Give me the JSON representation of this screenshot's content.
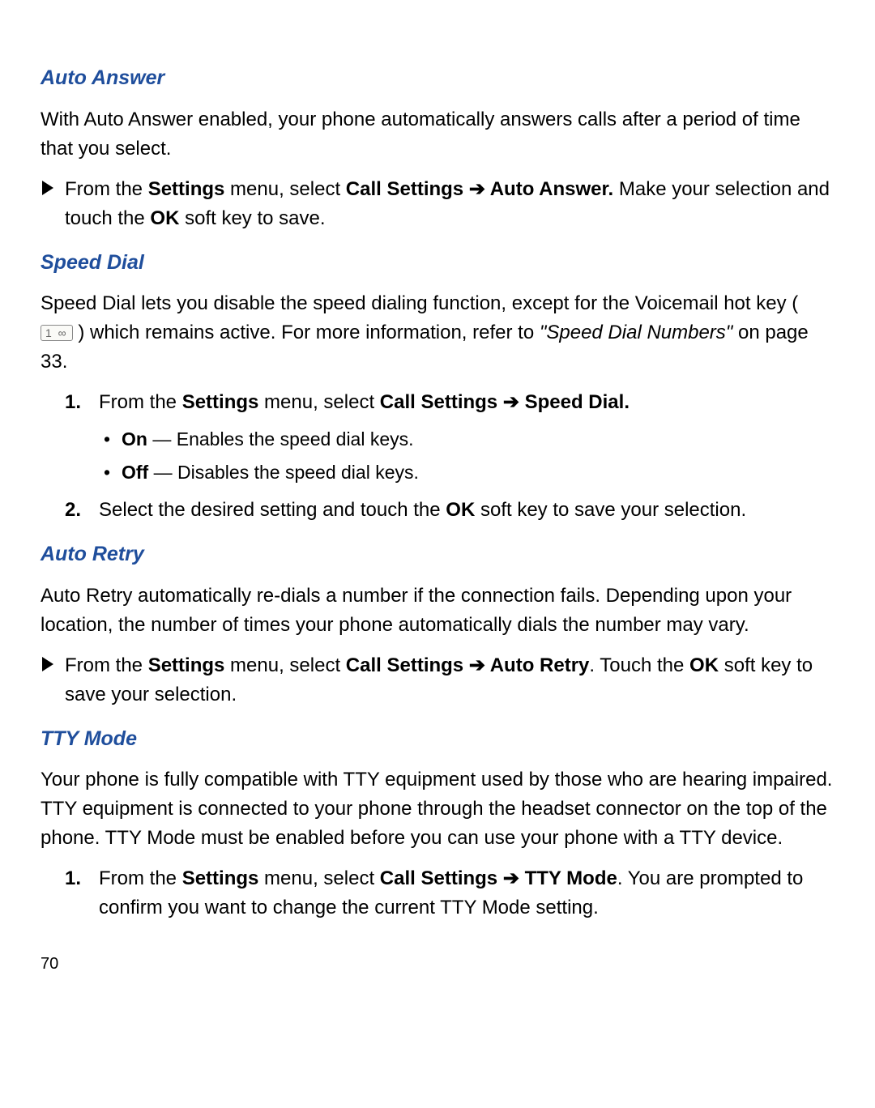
{
  "page": {
    "number": "70"
  },
  "autoAnswer": {
    "heading": "Auto Answer",
    "intro": "With Auto Answer enabled, your phone automatically answers calls after a period of time that you select.",
    "step": {
      "pre": "From the ",
      "settings": "Settings",
      "mid1": " menu, select ",
      "callSettings": "Call Settings",
      "arrow": " ➔ ",
      "target": "Auto Answer.",
      "mid2": " Make your selection and touch the ",
      "ok": "OK",
      "tail": " soft key to save."
    }
  },
  "speedDial": {
    "heading": "Speed Dial",
    "intro": {
      "a": "Speed Dial lets you disable the speed dialing function, except for the Voicemail hot key ( ",
      "keyIcon": "1 ∞",
      "b": " ) which remains active. For more information, refer to ",
      "ref": "\"Speed Dial Numbers\"",
      "c": "  on page 33."
    },
    "step1": {
      "num": "1.",
      "pre": "From the ",
      "settings": "Settings",
      "mid1": " menu, select ",
      "callSettings": "Call Settings",
      "arrow": " ➔ ",
      "target": "Speed Dial."
    },
    "opts": {
      "on": {
        "label": "On",
        "dash": " — ",
        "desc": "Enables the speed dial keys."
      },
      "off": {
        "label": "Off",
        "dash": " — ",
        "desc": "Disables the speed dial keys."
      }
    },
    "step2": {
      "num": "2.",
      "a": "Select the desired setting and touch the ",
      "ok": "OK",
      "b": " soft key to save your selection."
    }
  },
  "autoRetry": {
    "heading": "Auto Retry",
    "intro": "Auto Retry automatically re-dials a number if the connection fails. Depending upon your location, the number of times your phone automatically dials the number may vary.",
    "step": {
      "pre": "From the ",
      "settings": "Settings",
      "mid1": " menu, select ",
      "callSettings": "Call Settings",
      "arrow": " ➔ ",
      "target": "Auto Retry",
      "mid2": ". Touch the ",
      "ok": "OK",
      "tail": " soft key to save your selection."
    }
  },
  "ttyMode": {
    "heading": "TTY Mode",
    "intro": "Your phone is fully compatible with TTY equipment used by those who are hearing impaired. TTY equipment is connected to your phone through the headset connector on the top of the phone. TTY Mode must be enabled before you can use your phone with a TTY device.",
    "step1": {
      "num": "1.",
      "pre": "From the ",
      "settings": "Settings",
      "mid1": " menu, select ",
      "callSettings": "Call Settings",
      "arrow": " ➔ ",
      "target": "TTY Mode",
      "tail": ". You are prompted to confirm you want to change the current TTY Mode setting."
    }
  }
}
